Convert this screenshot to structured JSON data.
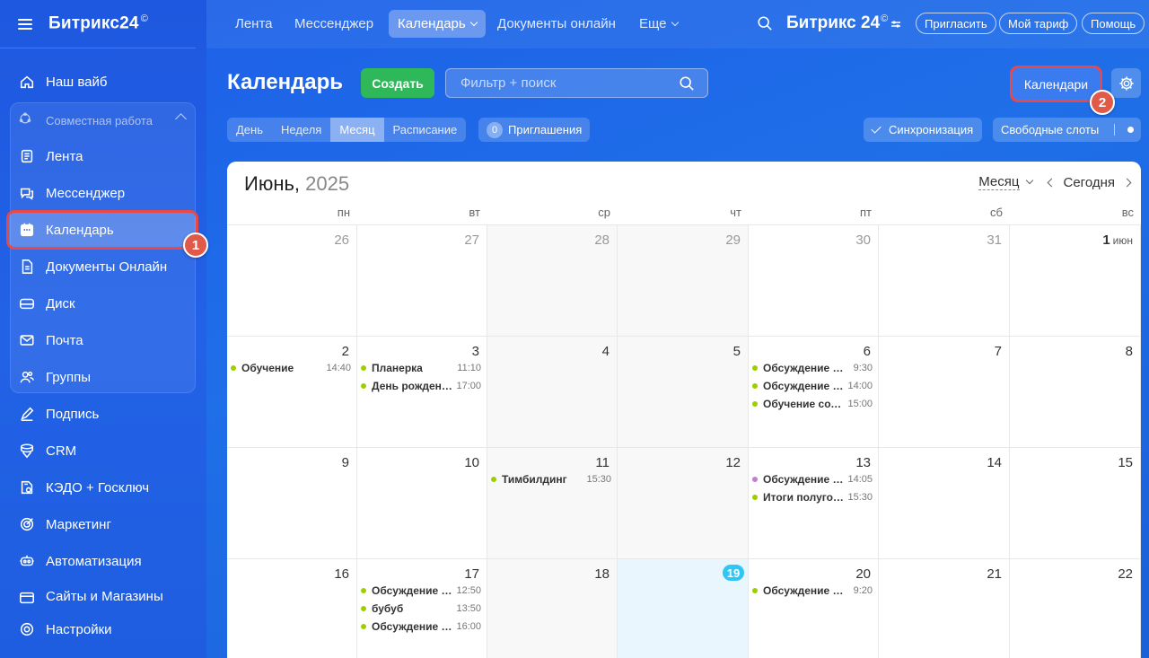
{
  "brand": {
    "name": "Битрикс24",
    "mark": "©"
  },
  "sidebar": {
    "items": [
      {
        "label": "Наш вайб",
        "icon": "home-icon"
      },
      {
        "label": "Совместная работа",
        "icon": "collab-icon"
      },
      {
        "label": "Лента",
        "icon": "feed-icon"
      },
      {
        "label": "Мессенджер",
        "icon": "chat-icon"
      },
      {
        "label": "Календарь",
        "icon": "calendar-icon"
      },
      {
        "label": "Документы Онлайн",
        "icon": "document-icon"
      },
      {
        "label": "Диск",
        "icon": "disk-icon"
      },
      {
        "label": "Почта",
        "icon": "mail-icon"
      },
      {
        "label": "Группы",
        "icon": "groups-icon"
      },
      {
        "label": "Подпись",
        "icon": "signature-icon"
      },
      {
        "label": "CRM",
        "icon": "crm-icon"
      },
      {
        "label": "КЭДО + Госключ",
        "icon": "kedo-icon"
      },
      {
        "label": "Маркетинг",
        "icon": "target-icon"
      },
      {
        "label": "Автоматизация",
        "icon": "robot-icon"
      },
      {
        "label": "Сайты и Магазины",
        "icon": "sites-icon"
      },
      {
        "label": "Настройки",
        "icon": "gear-icon"
      }
    ],
    "step_badge": "1"
  },
  "topnav": {
    "items": [
      "Лента",
      "Мессенджер",
      "Календарь",
      "Документы онлайн",
      "Еще"
    ],
    "brand": "Битрикс 24",
    "brand_mark": "©",
    "invite": "Пригласить",
    "tariff": "Мой тариф",
    "help": "Помощь"
  },
  "toolbar": {
    "title": "Календарь",
    "create": "Создать",
    "search_placeholder": "Фильтр + поиск",
    "calendars": "Календари",
    "step_badge": "2",
    "views": [
      "День",
      "Неделя",
      "Месяц",
      "Расписание"
    ],
    "selected_view": "Месяц",
    "invites_count": "0",
    "invites_label": "Приглашения",
    "sync": "Синхронизация",
    "slots": "Свободные слоты"
  },
  "calendar": {
    "month": "Июнь,",
    "year": "2025",
    "mode": "Месяц",
    "today_label": "Сегодня",
    "weekdays": [
      "пн",
      "вт",
      "ср",
      "чт",
      "пт",
      "сб",
      "вс"
    ],
    "weeks": [
      [
        {
          "d": "26",
          "muted": true
        },
        {
          "d": "27",
          "muted": true
        },
        {
          "d": "28",
          "muted": true,
          "gray": true
        },
        {
          "d": "29",
          "muted": true,
          "gray": true
        },
        {
          "d": "30",
          "muted": true
        },
        {
          "d": "31",
          "muted": true
        },
        {
          "d": "1",
          "suffix": "июн"
        }
      ],
      [
        {
          "d": "2",
          "events": [
            {
              "t": "Обучение",
              "tm": "14:40",
              "c": "#9dcf00"
            }
          ]
        },
        {
          "d": "3",
          "events": [
            {
              "t": "Планерка",
              "tm": "11:10",
              "c": "#9dcf00"
            },
            {
              "t": "День рождения",
              "tm": "17:00",
              "c": "#9dcf00"
            }
          ]
        },
        {
          "d": "4",
          "gray": true
        },
        {
          "d": "5",
          "gray": true
        },
        {
          "d": "6",
          "events": [
            {
              "t": "Обсуждение проекта",
              "tm": "9:30",
              "c": "#9dcf00"
            },
            {
              "t": "Обсуждение задач",
              "tm": "14:00",
              "c": "#9dcf00"
            },
            {
              "t": "Обучение сотрудников",
              "tm": "15:00",
              "c": "#9dcf00"
            }
          ]
        },
        {
          "d": "7"
        },
        {
          "d": "8"
        }
      ],
      [
        {
          "d": "9"
        },
        {
          "d": "10"
        },
        {
          "d": "11",
          "gray": true,
          "events": [
            {
              "t": "Тимбилдинг",
              "tm": "15:30",
              "c": "#9dcf00"
            }
          ]
        },
        {
          "d": "12",
          "gray": true
        },
        {
          "d": "13",
          "events": [
            {
              "t": "Обсуждение плана",
              "tm": "14:05",
              "c": "#c47ecf"
            },
            {
              "t": "Итоги полугодия",
              "tm": "15:30",
              "c": "#9dcf00"
            }
          ]
        },
        {
          "d": "14"
        },
        {
          "d": "15"
        }
      ],
      [
        {
          "d": "16"
        },
        {
          "d": "17",
          "events": [
            {
              "t": "Обсуждение задач",
              "tm": "12:50",
              "c": "#9dcf00"
            },
            {
              "t": "бубуб",
              "tm": "13:50",
              "c": "#9dcf00"
            },
            {
              "t": "Обсуждение проекта",
              "tm": "16:00",
              "c": "#9dcf00"
            }
          ]
        },
        {
          "d": "18",
          "gray": true
        },
        {
          "d": "19",
          "today": true
        },
        {
          "d": "20",
          "events": [
            {
              "t": "Обсуждение релиза",
              "tm": "9:20",
              "c": "#9dcf00"
            }
          ]
        },
        {
          "d": "21"
        },
        {
          "d": "22"
        }
      ]
    ]
  }
}
